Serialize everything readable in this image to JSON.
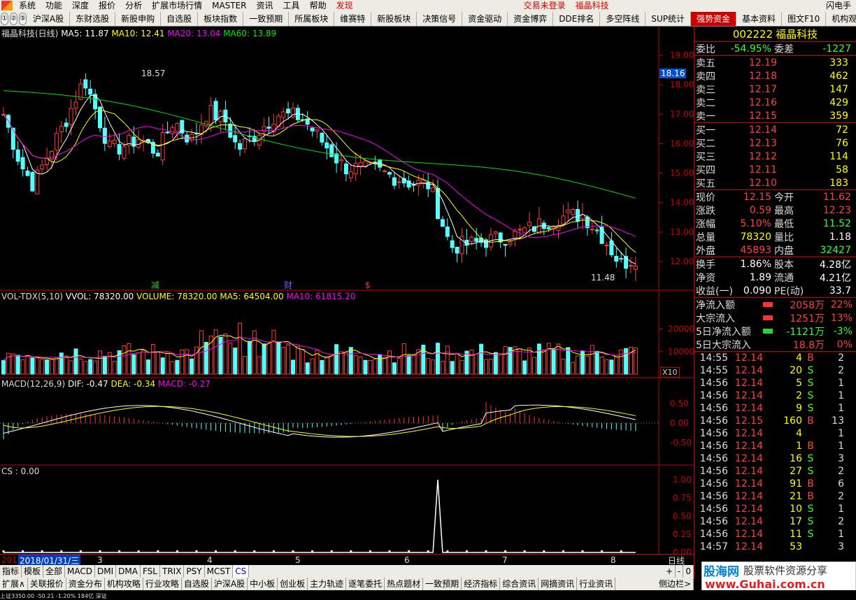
{
  "menu": {
    "items": [
      "系统",
      "功能",
      "深度",
      "报价",
      "分析",
      "扩展市场行情",
      "MASTER",
      "资讯",
      "工具",
      "帮助"
    ],
    "discover": "发现",
    "trade_status": "交易未登录",
    "stock_name": "福晶科技",
    "right_item": "闪电手"
  },
  "tabs": {
    "nums": [
      "①",
      "②",
      "⑤"
    ],
    "items": [
      "沪深A股",
      "东财选股",
      "新股申购",
      "自选股",
      "板块指数",
      "一致预期",
      "所属板块",
      "维赛特",
      "新股板块",
      "决策信号",
      "资金驱动",
      "资金博弈",
      "DDE排名",
      "多空阵线",
      "SUP统计",
      "强势资金",
      "基本资料",
      "图文F10",
      "机构观"
    ],
    "active": "强势资金"
  },
  "kline": {
    "title": "福晶科技(日线)",
    "ma5": "MA5: 11.87",
    "ma10": "MA10: 12.41",
    "ma20": "MA20: 13.04",
    "ma60": "MA60: 13.89",
    "high_label": "18.57",
    "low_label": "11.48",
    "price_tag": "18.16",
    "y_ticks": [
      "19.00",
      "18.00",
      "17.00",
      "16.00",
      "15.00",
      "14.00",
      "13.00",
      "12.00"
    ],
    "events": [
      "减",
      "财",
      "$"
    ],
    "colors": {
      "up": "#ff3c3c",
      "down": "#54ffff",
      "ma5": "#ffffff",
      "ma10": "#ffff00",
      "ma20": "#ff00ff",
      "ma60": "#00e000"
    }
  },
  "volume": {
    "title": "VOL-TDX(5,10)",
    "vvol": "VVOL: 78320.00",
    "vol": "VOLUME: 78320.00",
    "ma5": "MA5: 64504.00",
    "ma10": "MA10: 61815.20",
    "y_ticks": [
      "20000",
      "10000"
    ],
    "unit": "X10"
  },
  "macd": {
    "title": "MACD(12,26,9)",
    "dif": "DIF: -0.47",
    "dea": "DEA: -0.34",
    "macd": "MACD: -0.27",
    "y_ticks": [
      "0.50",
      "0.00",
      "-0.50"
    ]
  },
  "cs": {
    "title": "CS : 0.00",
    "y_ticks": [
      "1.00",
      "0.75",
      "0.50",
      "0.25",
      "0.00"
    ]
  },
  "timeline": {
    "prefix": "201",
    "selected_date": "2018/01/31/三",
    "months": [
      "3",
      "4",
      "5",
      "6",
      "7",
      "8"
    ],
    "period": "日线"
  },
  "indicator_tabs": [
    "指标",
    "模板",
    "全部",
    "MACD",
    "DMI",
    "DMA",
    "FSL",
    "TRIX",
    "PSY",
    "MCST",
    "CS"
  ],
  "indicator_selected": "CS",
  "zoom_buttons": [
    "+",
    "-",
    "0"
  ],
  "bottom_tabs": [
    "扩展∧",
    "关联报价",
    "资金分布",
    "机构攻略",
    "行业攻略",
    "自选股",
    "沪深A股",
    "中小板",
    "创业板",
    "主力轨迹",
    "逐笔委托",
    "热点题材",
    "一致预期",
    "经济指标",
    "综合资讯",
    "网摘资讯",
    "行业资讯"
  ],
  "sidebar_toggle": "侧边栏>",
  "quote": {
    "code": "002222",
    "name": "福晶科技",
    "weibi_label": "委比",
    "weibi": "-54.95%",
    "weicha_label": "委差",
    "weicha": "-1227",
    "asks": [
      {
        "label": "卖五",
        "price": "12.19",
        "vol": "333"
      },
      {
        "label": "卖四",
        "price": "12.18",
        "vol": "462"
      },
      {
        "label": "卖三",
        "price": "12.17",
        "vol": "147"
      },
      {
        "label": "卖二",
        "price": "12.16",
        "vol": "429"
      },
      {
        "label": "卖一",
        "price": "12.15",
        "vol": "359"
      }
    ],
    "bids": [
      {
        "label": "买一",
        "price": "12.14",
        "vol": "72"
      },
      {
        "label": "买二",
        "price": "12.13",
        "vol": "76"
      },
      {
        "label": "买三",
        "price": "12.12",
        "vol": "114"
      },
      {
        "label": "买四",
        "price": "12.11",
        "vol": "58"
      },
      {
        "label": "买五",
        "price": "12.10",
        "vol": "183"
      }
    ],
    "stats1": [
      {
        "l1": "现价",
        "v1": "12.15",
        "l2": "今开",
        "v2": "11.62"
      },
      {
        "l1": "涨跌",
        "v1": "0.59",
        "l2": "最高",
        "v2": "12.23"
      },
      {
        "l1": "涨幅",
        "v1": "5.10%",
        "l2": "最低",
        "v2": "11.52"
      },
      {
        "l1": "总量",
        "v1": "78320",
        "l2": "量比",
        "v2": "1.18"
      },
      {
        "l1": "外盘",
        "v1": "45893",
        "l2": "内盘",
        "v2": "32427"
      }
    ],
    "stats2": [
      {
        "l1": "换手",
        "v1": "1.86%",
        "l2": "股本",
        "v2": "4.28亿"
      },
      {
        "l1": "净资",
        "v1": "1.89",
        "l2": "流通",
        "v2": "4.21亿"
      },
      {
        "l1": "收益(一)",
        "v1": "0.090",
        "l2": "PE(动)",
        "v2": "33.7"
      }
    ],
    "flows": [
      {
        "label": "净流入额",
        "value": "2058万",
        "pct": "22%",
        "bar": "red"
      },
      {
        "label": "大宗流入",
        "value": "1251万",
        "pct": "13%",
        "bar": "red"
      },
      {
        "label": "5日净流入额",
        "value": "-1121万",
        "pct": "-3%",
        "bar": "green"
      },
      {
        "label": "5日大宗流入",
        "value": "18.8万",
        "pct": "0%",
        "bar": "none"
      }
    ],
    "ticks": [
      {
        "t": "14:55",
        "p": "12.14",
        "v": "4",
        "d": "B",
        "n": "2"
      },
      {
        "t": "14:55",
        "p": "12.14",
        "v": "20",
        "d": "S",
        "n": "2"
      },
      {
        "t": "14:56",
        "p": "12.14",
        "v": "5",
        "d": "S",
        "n": "1"
      },
      {
        "t": "14:56",
        "p": "12.14",
        "v": "2",
        "d": "S",
        "n": "1"
      },
      {
        "t": "14:56",
        "p": "12.14",
        "v": "9",
        "d": "S",
        "n": "1"
      },
      {
        "t": "14:56",
        "p": "12.15",
        "v": "160",
        "d": "B",
        "n": "13"
      },
      {
        "t": "14:56",
        "p": "12.14",
        "v": "4",
        "d": "",
        "n": "1"
      },
      {
        "t": "14:56",
        "p": "12.14",
        "v": "1",
        "d": "B",
        "n": "1"
      },
      {
        "t": "14:56",
        "p": "12.14",
        "v": "16",
        "d": "S",
        "n": "3"
      },
      {
        "t": "14:56",
        "p": "12.14",
        "v": "27",
        "d": "S",
        "n": "2"
      },
      {
        "t": "14:56",
        "p": "12.14",
        "v": "91",
        "d": "B",
        "n": "6"
      },
      {
        "t": "14:56",
        "p": "12.14",
        "v": "21",
        "d": "B",
        "n": "2"
      },
      {
        "t": "14:56",
        "p": "12.14",
        "v": "10",
        "d": "S",
        "n": "1"
      },
      {
        "t": "14:56",
        "p": "12.14",
        "v": "17",
        "d": "S",
        "n": "2"
      },
      {
        "t": "14:56",
        "p": "12.14",
        "v": "11",
        "d": "S",
        "n": "1"
      },
      {
        "t": "14:57",
        "p": "12.14",
        "v": "53",
        "d": "",
        "n": "3"
      }
    ]
  },
  "watermark": {
    "title": "股海网",
    "subtitle": "股票软件资源分享",
    "url": "www.Guhai.com.cn"
  },
  "status": {
    "text": "上证3350.00  -50.21  -1.20%  184亿   深证"
  }
}
